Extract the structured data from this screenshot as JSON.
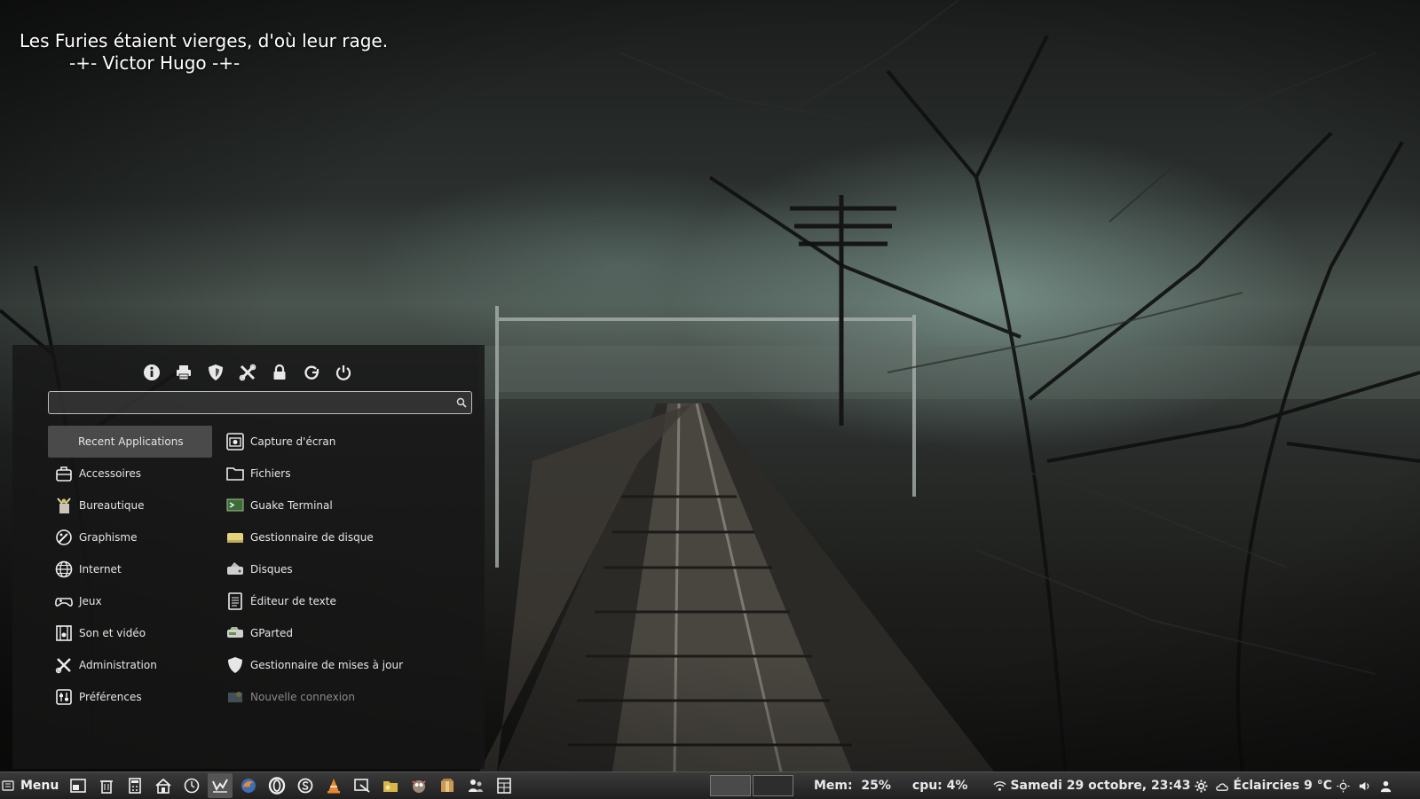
{
  "desktop": {
    "quote_line": "Les Furies étaient vierges, d'où leur rage.",
    "quote_author": "-+- Victor Hugo -+-"
  },
  "menu": {
    "toolbar": [
      {
        "icon": "info-icon"
      },
      {
        "icon": "printer-icon"
      },
      {
        "icon": "shield-icon"
      },
      {
        "icon": "tools-icon"
      },
      {
        "icon": "lock-icon"
      },
      {
        "icon": "logout-icon"
      },
      {
        "icon": "power-icon"
      }
    ],
    "search": {
      "value": "",
      "placeholder": ""
    },
    "categories": [
      {
        "label": "Recent Applications",
        "icon": "",
        "active": true
      },
      {
        "label": "Accessoires",
        "icon": "accessories-icon"
      },
      {
        "label": "Bureautique",
        "icon": "office-icon"
      },
      {
        "label": "Graphisme",
        "icon": "graphics-icon"
      },
      {
        "label": "Internet",
        "icon": "internet-icon"
      },
      {
        "label": "Jeux",
        "icon": "gamepad-icon"
      },
      {
        "label": "Son et vidéo",
        "icon": "multimedia-icon"
      },
      {
        "label": "Administration",
        "icon": "administration-icon"
      },
      {
        "label": "Préférences",
        "icon": "preferences-icon"
      }
    ],
    "apps": [
      {
        "label": "Capture d'écran",
        "icon": "screenshot-icon"
      },
      {
        "label": "Fichiers",
        "icon": "folder-icon"
      },
      {
        "label": "Guake Terminal",
        "icon": "terminal-icon"
      },
      {
        "label": "Gestionnaire de disque",
        "icon": "disk-manager-icon"
      },
      {
        "label": "Disques",
        "icon": "disks-icon"
      },
      {
        "label": "Éditeur de texte",
        "icon": "text-editor-icon"
      },
      {
        "label": "GParted",
        "icon": "gparted-icon"
      },
      {
        "label": "Gestionnaire de mises à jour",
        "icon": "update-shield-icon"
      },
      {
        "label": "Nouvelle connexion",
        "icon": "new-connection-icon",
        "dimmed": true
      }
    ]
  },
  "taskbar": {
    "menu_label": "Menu",
    "launchers": [
      "show-desktop-icon",
      "trash-icon",
      "calculator-icon",
      "home-icon",
      "clock-icon",
      "stock-chart-icon",
      "firefox-icon",
      "opera-icon",
      "skype-icon",
      "vlc-icon",
      "screenshot-tool-icon",
      "folder-app-icon",
      "gimp-icon",
      "package-icon",
      "users-icon",
      "calc-spreadsheet-icon"
    ],
    "active_launcher_index": 5,
    "workspaces": 2,
    "active_workspace": 0,
    "mem_label": "Mem:",
    "mem_value": "25%",
    "cpu_label": "cpu:",
    "cpu_value": "4%",
    "clock": "Samedi 29 octobre, 23:43",
    "weather": "Éclaircies 9 °C",
    "tray_icons": [
      "wifi-icon",
      "settings-gear-icon",
      "weather-icon",
      "brightness-icon",
      "volume-icon",
      "user-icon"
    ]
  }
}
